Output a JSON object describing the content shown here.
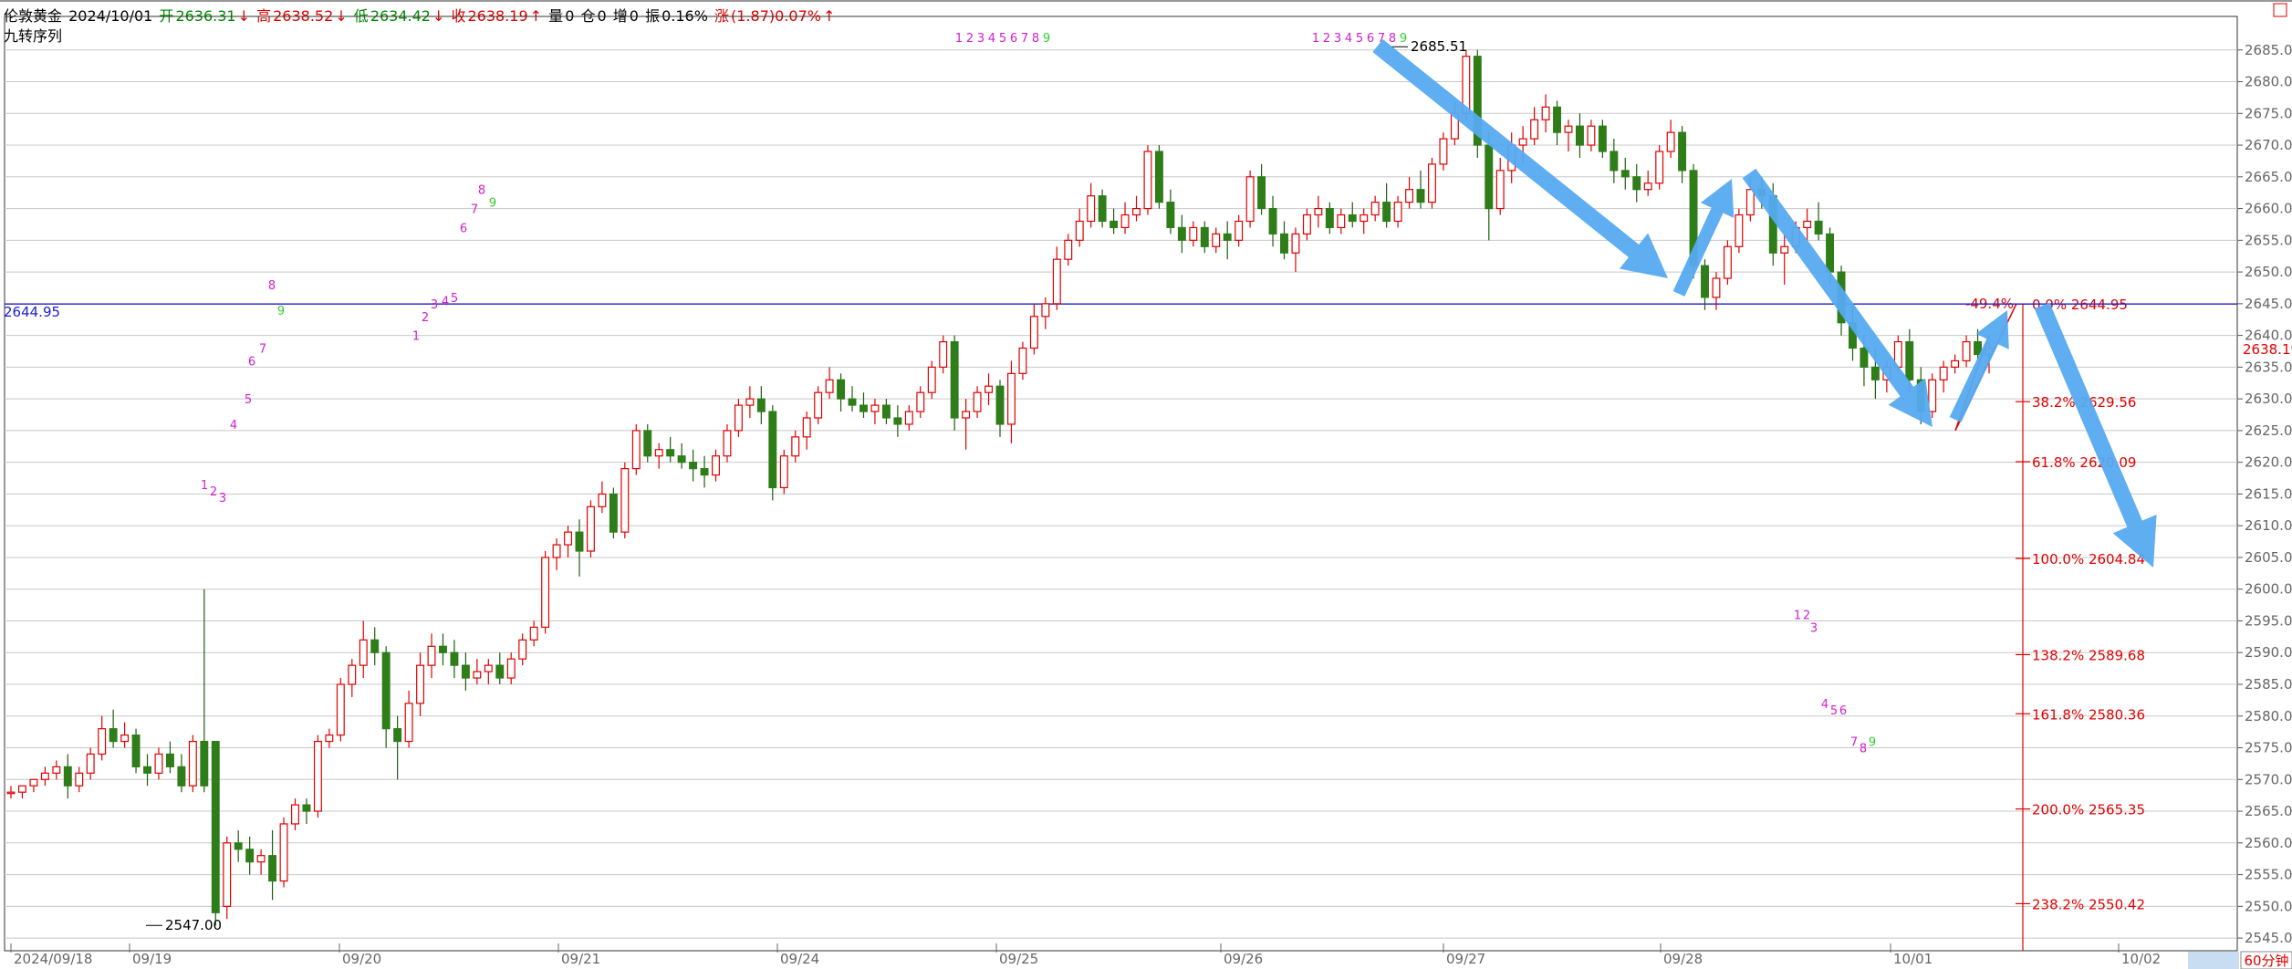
{
  "header": {
    "symbol": "伦敦黄金",
    "date": "2024/10/01",
    "open_label": "开",
    "open": "2636.31",
    "high_label": "高",
    "high": "2638.52",
    "low_label": "低",
    "low": "2634.42",
    "close_label": "收",
    "close": "2638.19",
    "vol_label": "量",
    "vol": "0",
    "oi_label": "仓",
    "oi": "0",
    "inc_label": "增",
    "inc": "0",
    "amp_label": "振",
    "amp": "0.16%",
    "chg_label": "涨",
    "chg": "(1.87)0.07%",
    "arrow_up": "↑",
    "arrow_down": "↓"
  },
  "indicator_name": "九转序列",
  "period": "60分钟",
  "colors": {
    "up": "#e00000",
    "down": "#2e7d19",
    "hline": "#2020d0",
    "fib": "#e00000",
    "arrow": "#55aaf0",
    "seq": "#d020d0",
    "seq9": "#33cc33"
  },
  "chart_data": {
    "type": "candlestick",
    "ylim": [
      2543,
      2690
    ],
    "yticks": [
      2545,
      2550,
      2555,
      2560,
      2565,
      2570,
      2575,
      2580,
      2585,
      2590,
      2595,
      2600,
      2605,
      2610,
      2615,
      2620,
      2625,
      2630,
      2635,
      2640,
      2645,
      2650,
      2655,
      2660,
      2665,
      2670,
      2675,
      2680,
      2685
    ],
    "x_labels": [
      "2024/09/18",
      "09/19",
      "09/20",
      "09/21",
      "09/24",
      "09/25",
      "09/26",
      "09/27",
      "09/28",
      "10/01",
      "10/02"
    ],
    "hline": {
      "value": 2644.95,
      "label": "2644.95"
    },
    "last_price": {
      "value": 2638.19,
      "label": "2638.19"
    },
    "annotations": [
      {
        "label": "2685.51",
        "value": 2685.51
      },
      {
        "label": "2547.00",
        "value": 2547.0
      }
    ],
    "fib_levels": [
      {
        "label": "-49.4%",
        "value": 2644.95
      },
      {
        "label": "0.0% 2644.95",
        "value": 2644.95
      },
      {
        "label": "38.2% 2629.56",
        "value": 2629.56
      },
      {
        "label": "61.8% 2620.09",
        "value": 2620.09
      },
      {
        "label": "100.0% 2604.84",
        "value": 2604.84
      },
      {
        "label": "138.2% 2589.68",
        "value": 2589.68
      },
      {
        "label": "161.8% 2580.36",
        "value": 2580.36
      },
      {
        "label": "200.0% 2565.35",
        "value": 2565.35
      },
      {
        "label": "238.2% 2550.42",
        "value": 2550.42
      }
    ],
    "td_sequences": [
      {
        "labels": [
          "1",
          "2",
          "3"
        ],
        "values": [
          2616.5,
          2615.5,
          2614.5
        ]
      },
      {
        "labels": [
          "4",
          "5",
          "6",
          "7",
          "8",
          "9"
        ],
        "values": [
          2626,
          2630,
          2636,
          2638,
          2648,
          2644
        ]
      },
      {
        "labels": [
          "1",
          "2",
          "3",
          "4",
          "5"
        ],
        "values": [
          2640,
          2643,
          2645,
          2645.5,
          2646
        ]
      },
      {
        "labels": [
          "6",
          "7",
          "8",
          "9"
        ],
        "values": [
          2657,
          2660,
          2663,
          2661
        ]
      },
      {
        "labels": [
          "1",
          "2",
          "3",
          "4",
          "5",
          "6",
          "7",
          "8",
          "9"
        ],
        "values": [
          2687,
          2687,
          2687,
          2687,
          2687,
          2687,
          2687,
          2687,
          2687
        ]
      },
      {
        "labels": [
          "1",
          "2",
          "3",
          "4",
          "5",
          "6",
          "7",
          "8",
          "9"
        ],
        "values": [
          2687,
          2687,
          2687,
          2687,
          2687,
          2687,
          2687,
          2687,
          2687
        ]
      },
      {
        "labels": [
          "1",
          "2",
          "3"
        ],
        "values": [
          2596,
          2596,
          2594
        ]
      },
      {
        "labels": [
          "4",
          "5",
          "6"
        ],
        "values": [
          2582,
          2581,
          2581
        ]
      },
      {
        "labels": [
          "7",
          "8",
          "9"
        ],
        "values": [
          2576,
          2575,
          2576
        ]
      }
    ],
    "candles": [
      [
        2568,
        2569,
        2567,
        2568
      ],
      [
        2568,
        2569,
        2567,
        2569
      ],
      [
        2569,
        2570,
        2568,
        2570
      ],
      [
        2570,
        2572,
        2569,
        2571
      ],
      [
        2571,
        2573,
        2570,
        2572
      ],
      [
        2572,
        2574,
        2567,
        2569
      ],
      [
        2569,
        2572,
        2568,
        2571
      ],
      [
        2571,
        2575,
        2570,
        2574
      ],
      [
        2574,
        2580,
        2573,
        2578
      ],
      [
        2578,
        2581,
        2575,
        2576
      ],
      [
        2576,
        2579,
        2575,
        2577
      ],
      [
        2577,
        2578,
        2571,
        2572
      ],
      [
        2572,
        2574,
        2569,
        2571
      ],
      [
        2571,
        2575,
        2570,
        2574
      ],
      [
        2574,
        2576,
        2571,
        2572
      ],
      [
        2572,
        2574,
        2568,
        2569
      ],
      [
        2569,
        2577,
        2568,
        2576
      ],
      [
        2576,
        2600,
        2568,
        2569
      ],
      [
        2576,
        2576,
        2547,
        2549
      ],
      [
        2550,
        2561,
        2548,
        2560
      ],
      [
        2560,
        2562,
        2557,
        2559
      ],
      [
        2559,
        2561,
        2555,
        2557
      ],
      [
        2557,
        2559,
        2555,
        2558
      ],
      [
        2558,
        2562,
        2551,
        2554
      ],
      [
        2554,
        2564,
        2553,
        2563
      ],
      [
        2563,
        2567,
        2562,
        2566
      ],
      [
        2566,
        2567,
        2563,
        2565
      ],
      [
        2565,
        2577,
        2564,
        2576
      ],
      [
        2576,
        2578,
        2575,
        2577
      ],
      [
        2577,
        2586,
        2576,
        2585
      ],
      [
        2585,
        2589,
        2583,
        2588
      ],
      [
        2588,
        2595,
        2586,
        2592
      ],
      [
        2592,
        2594,
        2588,
        2590
      ],
      [
        2590,
        2591,
        2575,
        2578
      ],
      [
        2578,
        2580,
        2570,
        2576
      ],
      [
        2576,
        2584,
        2575,
        2582
      ],
      [
        2582,
        2590,
        2580,
        2588
      ],
      [
        2588,
        2593,
        2586,
        2591
      ],
      [
        2591,
        2593,
        2588,
        2590
      ],
      [
        2590,
        2592,
        2586,
        2588
      ],
      [
        2588,
        2590,
        2584,
        2586
      ],
      [
        2586,
        2589,
        2585,
        2587
      ],
      [
        2587,
        2589,
        2585,
        2588
      ],
      [
        2588,
        2590,
        2585,
        2586
      ],
      [
        2586,
        2590,
        2585,
        2589
      ],
      [
        2589,
        2593,
        2588,
        2592
      ],
      [
        2592,
        2595,
        2591,
        2594
      ],
      [
        2594,
        2606,
        2593,
        2605
      ],
      [
        2605,
        2608,
        2603,
        2607
      ],
      [
        2607,
        2610,
        2605,
        2609
      ],
      [
        2609,
        2611,
        2602,
        2606
      ],
      [
        2606,
        2614,
        2605,
        2613
      ],
      [
        2613,
        2617,
        2612,
        2615
      ],
      [
        2615,
        2616,
        2608,
        2609
      ],
      [
        2609,
        2620,
        2608,
        2619
      ],
      [
        2619,
        2626,
        2618,
        2625
      ],
      [
        2625,
        2626,
        2620,
        2621
      ],
      [
        2621,
        2623,
        2619,
        2622
      ],
      [
        2622,
        2624,
        2620,
        2621
      ],
      [
        2621,
        2623,
        2619,
        2620
      ],
      [
        2620,
        2622,
        2617,
        2619
      ],
      [
        2619,
        2621,
        2616,
        2618
      ],
      [
        2618,
        2622,
        2617,
        2621
      ],
      [
        2621,
        2626,
        2620,
        2625
      ],
      [
        2625,
        2630,
        2624,
        2629
      ],
      [
        2629,
        2632,
        2627,
        2630
      ],
      [
        2630,
        2632,
        2626,
        2628
      ],
      [
        2628,
        2629,
        2614,
        2616
      ],
      [
        2616,
        2622,
        2615,
        2621
      ],
      [
        2621,
        2625,
        2620,
        2624
      ],
      [
        2624,
        2628,
        2622,
        2627
      ],
      [
        2627,
        2632,
        2626,
        2631
      ],
      [
        2631,
        2635,
        2630,
        2633
      ],
      [
        2633,
        2634,
        2628,
        2630
      ],
      [
        2630,
        2632,
        2628,
        2629
      ],
      [
        2629,
        2631,
        2627,
        2628
      ],
      [
        2628,
        2630,
        2626,
        2629
      ],
      [
        2629,
        2630,
        2626,
        2627
      ],
      [
        2627,
        2629,
        2624,
        2626
      ],
      [
        2626,
        2629,
        2625,
        2628
      ],
      [
        2628,
        2632,
        2627,
        2631
      ],
      [
        2631,
        2636,
        2630,
        2635
      ],
      [
        2635,
        2640,
        2634,
        2639
      ],
      [
        2639,
        2640,
        2625,
        2627
      ],
      [
        2627,
        2630,
        2622,
        2628
      ],
      [
        2628,
        2632,
        2627,
        2631
      ],
      [
        2631,
        2634,
        2629,
        2632
      ],
      [
        2632,
        2633,
        2624,
        2626
      ],
      [
        2626,
        2636,
        2623,
        2634
      ],
      [
        2634,
        2639,
        2633,
        2638
      ],
      [
        2638,
        2645,
        2637,
        2643
      ],
      [
        2643,
        2646,
        2641,
        2645
      ],
      [
        2645,
        2654,
        2644,
        2652
      ],
      [
        2652,
        2656,
        2651,
        2655
      ],
      [
        2655,
        2660,
        2654,
        2658
      ],
      [
        2658,
        2664,
        2657,
        2662
      ],
      [
        2662,
        2663,
        2657,
        2658
      ],
      [
        2658,
        2660,
        2656,
        2657
      ],
      [
        2657,
        2661,
        2656,
        2659
      ],
      [
        2659,
        2662,
        2658,
        2660
      ],
      [
        2660,
        2670,
        2659,
        2669
      ],
      [
        2669,
        2670,
        2660,
        2661
      ],
      [
        2661,
        2663,
        2656,
        2657
      ],
      [
        2657,
        2659,
        2653,
        2655
      ],
      [
        2655,
        2658,
        2654,
        2657
      ],
      [
        2657,
        2658,
        2653,
        2654
      ],
      [
        2654,
        2657,
        2653,
        2656
      ],
      [
        2656,
        2658,
        2652,
        2655
      ],
      [
        2655,
        2659,
        2654,
        2658
      ],
      [
        2658,
        2666,
        2657,
        2665
      ],
      [
        2665,
        2667,
        2659,
        2660
      ],
      [
        2660,
        2662,
        2654,
        2656
      ],
      [
        2656,
        2658,
        2652,
        2653
      ],
      [
        2653,
        2657,
        2650,
        2656
      ],
      [
        2656,
        2660,
        2655,
        2659
      ],
      [
        2659,
        2662,
        2657,
        2660
      ],
      [
        2660,
        2661,
        2656,
        2657
      ],
      [
        2657,
        2660,
        2656,
        2659
      ],
      [
        2659,
        2661,
        2657,
        2658
      ],
      [
        2658,
        2660,
        2656,
        2659
      ],
      [
        2659,
        2662,
        2658,
        2661
      ],
      [
        2661,
        2664,
        2657,
        2658
      ],
      [
        2658,
        2662,
        2657,
        2661
      ],
      [
        2661,
        2665,
        2660,
        2663
      ],
      [
        2663,
        2666,
        2660,
        2661
      ],
      [
        2661,
        2668,
        2660,
        2667
      ],
      [
        2667,
        2672,
        2666,
        2671
      ],
      [
        2671,
        2677,
        2670,
        2675
      ],
      [
        2675,
        2685,
        2674,
        2684
      ],
      [
        2684,
        2685,
        2668,
        2670
      ],
      [
        2670,
        2672,
        2655,
        2660
      ],
      [
        2660,
        2668,
        2659,
        2666
      ],
      [
        2666,
        2672,
        2664,
        2670
      ],
      [
        2670,
        2673,
        2667,
        2671
      ],
      [
        2671,
        2676,
        2670,
        2674
      ],
      [
        2674,
        2678,
        2672,
        2676
      ],
      [
        2676,
        2677,
        2670,
        2672
      ],
      [
        2672,
        2674,
        2669,
        2673
      ],
      [
        2673,
        2675,
        2668,
        2670
      ],
      [
        2670,
        2674,
        2669,
        2673
      ],
      [
        2673,
        2674,
        2668,
        2669
      ],
      [
        2669,
        2671,
        2664,
        2666
      ],
      [
        2666,
        2668,
        2663,
        2665
      ],
      [
        2665,
        2667,
        2661,
        2663
      ],
      [
        2663,
        2666,
        2662,
        2664
      ],
      [
        2664,
        2670,
        2663,
        2669
      ],
      [
        2669,
        2674,
        2668,
        2672
      ],
      [
        2672,
        2673,
        2664,
        2666
      ],
      [
        2666,
        2667,
        2649,
        2651
      ],
      [
        2651,
        2652,
        2644,
        2646
      ],
      [
        2646,
        2650,
        2644,
        2649
      ],
      [
        2649,
        2655,
        2648,
        2654
      ],
      [
        2654,
        2660,
        2653,
        2659
      ],
      [
        2659,
        2665,
        2658,
        2663
      ],
      [
        2663,
        2665,
        2660,
        2662
      ],
      [
        2662,
        2664,
        2651,
        2653
      ],
      [
        2653,
        2656,
        2648,
        2654
      ],
      [
        2654,
        2658,
        2653,
        2657
      ],
      [
        2657,
        2660,
        2655,
        2658
      ],
      [
        2658,
        2661,
        2655,
        2656
      ],
      [
        2656,
        2657,
        2648,
        2650
      ],
      [
        2650,
        2651,
        2640,
        2642
      ],
      [
        2642,
        2645,
        2636,
        2638
      ],
      [
        2638,
        2640,
        2632,
        2635
      ],
      [
        2635,
        2638,
        2630,
        2633
      ],
      [
        2633,
        2636,
        2631,
        2635
      ],
      [
        2635,
        2640,
        2634,
        2639
      ],
      [
        2639,
        2641,
        2631,
        2633
      ],
      [
        2633,
        2635,
        2626,
        2628
      ],
      [
        2628,
        2634,
        2627,
        2633
      ],
      [
        2633,
        2636,
        2631,
        2635
      ],
      [
        2635,
        2637,
        2634,
        2636
      ],
      [
        2636,
        2640,
        2635,
        2639
      ],
      [
        2639,
        2641,
        2636,
        2637
      ],
      [
        2637,
        2639,
        2634,
        2638
      ]
    ]
  }
}
